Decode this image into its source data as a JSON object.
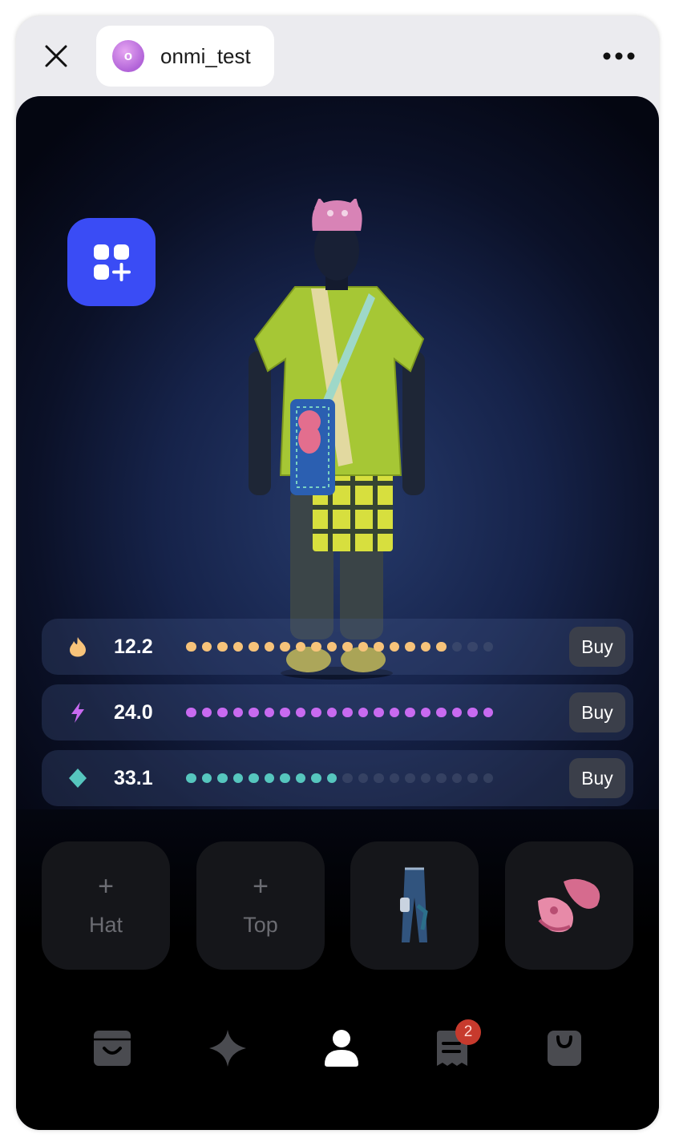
{
  "header": {
    "username": "onmi_test",
    "avatar_letter": "o"
  },
  "colors": {
    "accent": "#3a4cf5",
    "flame": "#f7c37a",
    "bolt": "#c86af0",
    "gem": "#56c6be",
    "badge": "#c73a2d"
  },
  "stats": [
    {
      "icon": "flame-icon",
      "value": "12.2",
      "filled": 17,
      "total": 20,
      "buy_label": "Buy"
    },
    {
      "icon": "bolt-icon",
      "value": "24.0",
      "filled": 20,
      "total": 20,
      "buy_label": "Buy"
    },
    {
      "icon": "diamond-icon",
      "value": "33.1",
      "filled": 10,
      "total": 20,
      "buy_label": "Buy"
    }
  ],
  "slots": [
    {
      "type": "empty",
      "plus": "+",
      "label": "Hat"
    },
    {
      "type": "empty",
      "plus": "+",
      "label": "Top"
    },
    {
      "type": "item",
      "icon": "pants-icon"
    },
    {
      "type": "item",
      "icon": "shoes-icon"
    }
  ],
  "nav": {
    "items": [
      {
        "icon": "shop-box-icon",
        "active": false
      },
      {
        "icon": "sparkle-icon",
        "active": false
      },
      {
        "icon": "profile-icon",
        "active": true
      },
      {
        "icon": "receipt-icon",
        "active": false
      },
      {
        "icon": "bag-icon",
        "active": false
      }
    ],
    "receipt_badge": "2"
  }
}
